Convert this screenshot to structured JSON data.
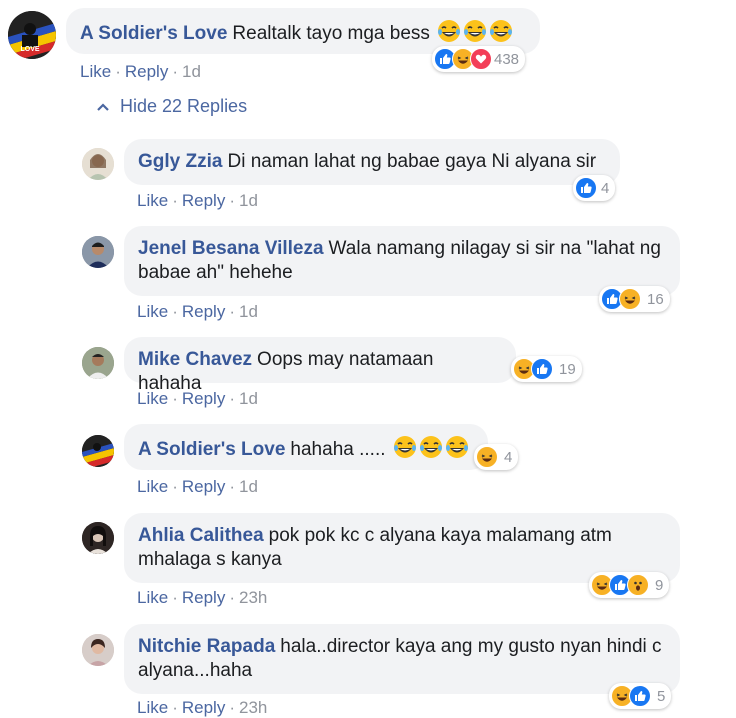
{
  "colors": {
    "link": "#385898",
    "action": "#4b67a1",
    "muted": "#90949c",
    "bubble": "#f2f3f5",
    "like_blue": "#1877f2",
    "haha_yellow": "#f7b125",
    "love_red": "#f33e58"
  },
  "actions": {
    "like": "Like",
    "reply": "Reply",
    "sep": "·"
  },
  "hide_replies": {
    "label": "Hide 22 Replies",
    "icon": "chevron-up-icon"
  },
  "comments": [
    {
      "author": "A Soldier's Love",
      "text": "Realtalk tayo mga bess",
      "emoji_count": 3,
      "time": "1d",
      "reaction_count": "438",
      "reactions": [
        "like",
        "haha",
        "love"
      ]
    },
    {
      "author": "Ggly Zzia",
      "text": "Di naman lahat ng babae gaya Ni alyana sir",
      "time": "1d",
      "reaction_count": "4",
      "reactions": [
        "like"
      ]
    },
    {
      "author": "Jenel Besana Villeza",
      "text": "Wala namang nilagay si sir na \"lahat ng babae ah\" hehehe",
      "time": "1d",
      "reaction_count": "16",
      "reactions": [
        "like",
        "haha"
      ]
    },
    {
      "author": "Mike Chavez",
      "text": "Oops may natamaan hahaha",
      "time": "1d",
      "reaction_count": "19",
      "reactions": [
        "haha",
        "like"
      ]
    },
    {
      "author": "A Soldier's Love",
      "text": "hahaha .....",
      "emoji_count": 3,
      "time": "1d",
      "reaction_count": "4",
      "reactions": [
        "haha"
      ]
    },
    {
      "author": "Ahlia Calithea",
      "text": "pok pok kc c alyana kaya malamang atm mhalaga s kanya",
      "time": "23h",
      "reaction_count": "9",
      "reactions": [
        "haha",
        "like",
        "wow"
      ]
    },
    {
      "author": "Nitchie Rapada",
      "text": "hala..director kaya ang my gusto nyan hindi c alyana...haha",
      "time": "23h",
      "reaction_count": "5",
      "reactions": [
        "haha",
        "like"
      ]
    }
  ]
}
